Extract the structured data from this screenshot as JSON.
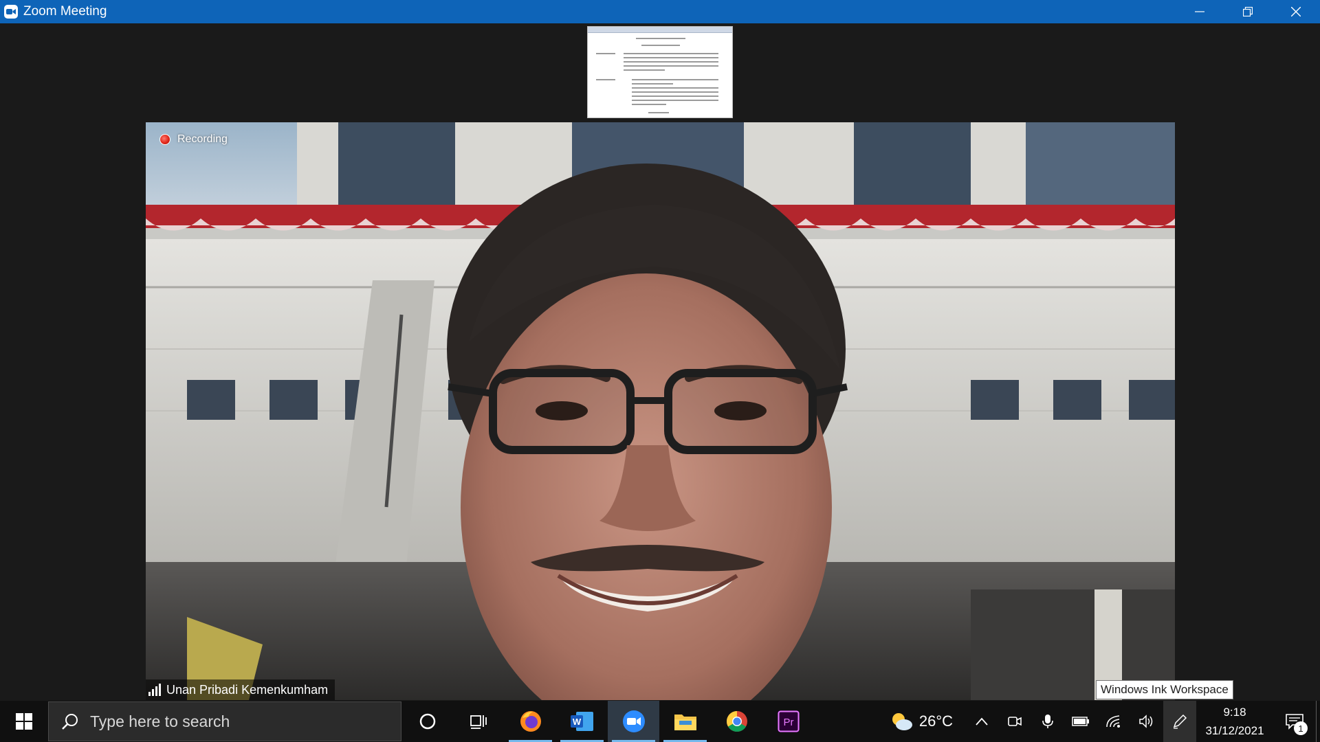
{
  "window": {
    "title": "Zoom Meeting",
    "icon": "zoom-camera-icon",
    "controls": [
      "minimize-icon",
      "restore-icon",
      "close-icon"
    ]
  },
  "meeting": {
    "recording_label": "Recording",
    "participant_name": "Unan Pribadi Kemenkumham",
    "shared_document": "document-thumbnail",
    "tooltip": "Windows Ink Workspace",
    "colors": {
      "title_bar": "#0e64b8",
      "recording_dot": "#e0281b",
      "stage_background": "#1a1a1a"
    }
  },
  "taskbar": {
    "search_placeholder": "Type here to search",
    "pinned_apps": [
      {
        "name": "cortana-icon"
      },
      {
        "name": "task-view-icon"
      },
      {
        "name": "firefox-icon",
        "running": true
      },
      {
        "name": "word-icon",
        "running": true
      },
      {
        "name": "zoom-icon",
        "running": true,
        "active": true
      },
      {
        "name": "file-explorer-icon",
        "running": true
      },
      {
        "name": "chrome-icon"
      },
      {
        "name": "premiere-pro-icon"
      }
    ],
    "weather": {
      "temperature": "26°C",
      "icon": "partly-cloudy-icon"
    },
    "tray_icons": [
      "chevron-up-icon",
      "camera-icon",
      "microphone-icon",
      "battery-icon",
      "wifi-icon",
      "volume-icon",
      "pen-icon"
    ],
    "clock": {
      "time": "9:18",
      "date": "31/12/2021"
    },
    "notifications": {
      "count": "1"
    }
  }
}
